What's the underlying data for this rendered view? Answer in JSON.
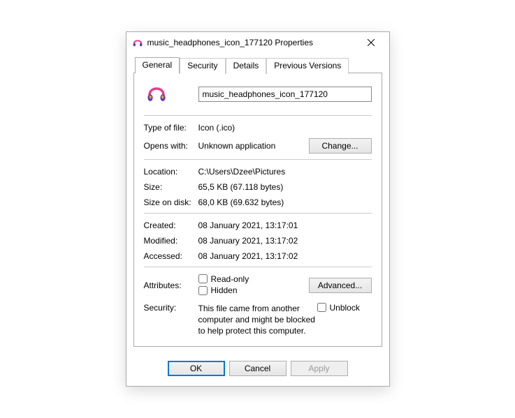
{
  "title": "music_headphones_icon_177120 Properties",
  "tabs": [
    "General",
    "Security",
    "Details",
    "Previous Versions"
  ],
  "activeTab": 0,
  "filename": "music_headphones_icon_177120",
  "fields": {
    "typeOfFile": {
      "label": "Type of file:",
      "value": "Icon (.ico)"
    },
    "opensWith": {
      "label": "Opens with:",
      "value": "Unknown application",
      "changeBtn": "Change..."
    },
    "location": {
      "label": "Location:",
      "value": "C:\\Users\\Dzee\\Pictures"
    },
    "size": {
      "label": "Size:",
      "value": "65,5 KB (67.118 bytes)"
    },
    "sizeOnDisk": {
      "label": "Size on disk:",
      "value": "68,0 KB (69.632 bytes)"
    },
    "created": {
      "label": "Created:",
      "value": "08 January 2021, 13:17:01"
    },
    "modified": {
      "label": "Modified:",
      "value": "08 January 2021, 13:17:02"
    },
    "accessed": {
      "label": "Accessed:",
      "value": "08 January 2021, 13:17:02"
    }
  },
  "attributes": {
    "label": "Attributes:",
    "readonly": "Read-only",
    "hidden": "Hidden",
    "advancedBtn": "Advanced..."
  },
  "security": {
    "label": "Security:",
    "text": "This file came from another computer and might be blocked to help protect this computer.",
    "unblock": "Unblock"
  },
  "buttons": {
    "ok": "OK",
    "cancel": "Cancel",
    "apply": "Apply"
  }
}
